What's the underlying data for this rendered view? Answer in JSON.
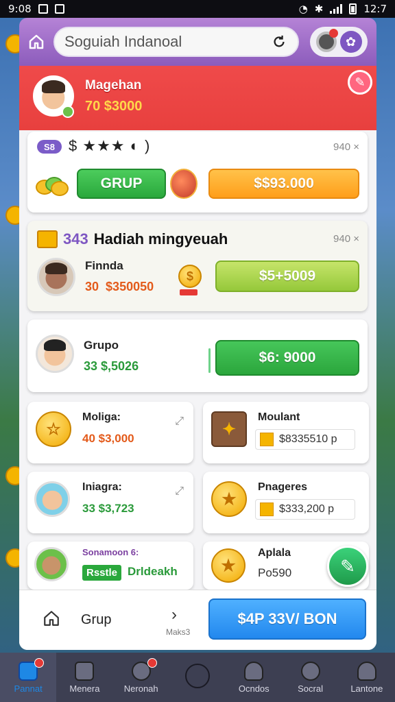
{
  "status_bar": {
    "time_left": "9:08",
    "time_right": "12:7"
  },
  "header": {
    "search_value": "Soguiah Indanoal"
  },
  "profile": {
    "name": "Magehan",
    "balance": "70 $3000"
  },
  "card1": {
    "tag": "S8",
    "stars_text": "$ ★★★ ◐ )",
    "meta": "940 ×",
    "grup_label": "GRUP",
    "amount_button": "$$93.000"
  },
  "card2": {
    "count": "343",
    "title": "Hadiah mingyeuah",
    "meta": "940 ×",
    "name": "Finnda",
    "amount_prefix": "30",
    "amount": "$350050",
    "button": "$5+5009"
  },
  "card3": {
    "name": "Grupo",
    "amount": "33  $,5026",
    "button": "$6: 9000"
  },
  "minis": [
    {
      "name": "Moliga:",
      "amount": "40  $3,000"
    },
    {
      "name": "Moulant",
      "amount": "$8335510 p"
    },
    {
      "name": "Iniagra:",
      "amount": "33  $3,723"
    },
    {
      "name": "Pnageres",
      "amount": "$333,200 p"
    },
    {
      "name": "Sonamoon 6:",
      "chip": "Rsstle",
      "extra": "Drldeakh"
    },
    {
      "name": "Aplala",
      "amount": "Po590"
    }
  ],
  "footer": {
    "label": "Grup",
    "small": "Maks3",
    "button": "$4P 33V/ BON"
  },
  "bottom_nav": [
    {
      "label": "Pannat"
    },
    {
      "label": "Menera"
    },
    {
      "label": "Neronah"
    },
    {
      "label": ""
    },
    {
      "label": "Ocndos"
    },
    {
      "label": "Socral"
    },
    {
      "label": "Lantone"
    }
  ],
  "colors": {
    "accent_purple": "#9b6fcb",
    "profile_red": "#e8403e",
    "green": "#2aa83c",
    "orange": "#ff9e1a",
    "blue": "#2288ee"
  }
}
